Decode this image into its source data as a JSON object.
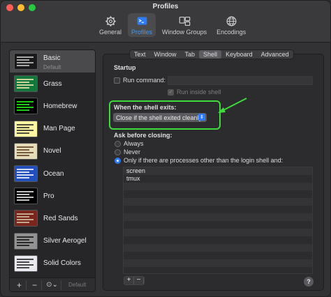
{
  "window": {
    "title": "Profiles"
  },
  "toolbar": {
    "items": [
      {
        "label": "General",
        "icon": "gear-icon",
        "active": false
      },
      {
        "label": "Profiles",
        "icon": "profiles-icon",
        "active": true
      },
      {
        "label": "Window Groups",
        "icon": "window-groups-icon",
        "active": false
      },
      {
        "label": "Encodings",
        "icon": "globe-icon",
        "active": false
      }
    ]
  },
  "sidebar": {
    "profiles": [
      {
        "name": "Basic",
        "subtitle": "Default",
        "selected": true,
        "bg": "#1a1a1a",
        "fg": "#cccccc"
      },
      {
        "name": "Grass",
        "bg": "#13773d",
        "fg": "#f7e9b0"
      },
      {
        "name": "Homebrew",
        "bg": "#000000",
        "fg": "#28fe14"
      },
      {
        "name": "Man Page",
        "bg": "#fdf6a3",
        "fg": "#222222"
      },
      {
        "name": "Novel",
        "bg": "#e6dcb9",
        "fg": "#5a3b1d"
      },
      {
        "name": "Ocean",
        "bg": "#224fbc",
        "fg": "#ffffff"
      },
      {
        "name": "Pro",
        "bg": "#000000",
        "fg": "#f2f2f2"
      },
      {
        "name": "Red Sands",
        "bg": "#7a251e",
        "fg": "#d7c9a7"
      },
      {
        "name": "Silver Aerogel",
        "bg": "#929292",
        "fg": "#111111"
      },
      {
        "name": "Solid Colors",
        "bg": "#e8e8f0",
        "fg": "#222222"
      }
    ],
    "bottom": {
      "add_label": "+",
      "remove_label": "−",
      "gear_label": "⊙⌄",
      "default_label": "Default"
    }
  },
  "tabs": [
    {
      "label": "Text",
      "active": false
    },
    {
      "label": "Window",
      "active": false
    },
    {
      "label": "Tab",
      "active": false
    },
    {
      "label": "Shell",
      "active": true
    },
    {
      "label": "Keyboard",
      "active": false
    },
    {
      "label": "Advanced",
      "active": false
    }
  ],
  "startup": {
    "heading": "Startup",
    "run_command_label": "Run command:",
    "run_command_value": "",
    "run_inside_shell_label": "Run inside shell"
  },
  "shell_exit": {
    "heading": "When the shell exits:",
    "selected_option": "Close if the shell exited cleanly"
  },
  "ask_before_closing": {
    "heading": "Ask before closing:",
    "options": [
      {
        "label": "Always",
        "selected": false
      },
      {
        "label": "Never",
        "selected": false
      },
      {
        "label": "Only if there are processes other than the login shell and:",
        "selected": true
      }
    ],
    "processes": [
      "screen",
      "tmux"
    ]
  },
  "list_buttons": {
    "add_label": "+",
    "remove_label": "−"
  },
  "help_label": "?",
  "colors": {
    "accent": "#2f7bf5",
    "highlight": "#3ddc3d"
  }
}
